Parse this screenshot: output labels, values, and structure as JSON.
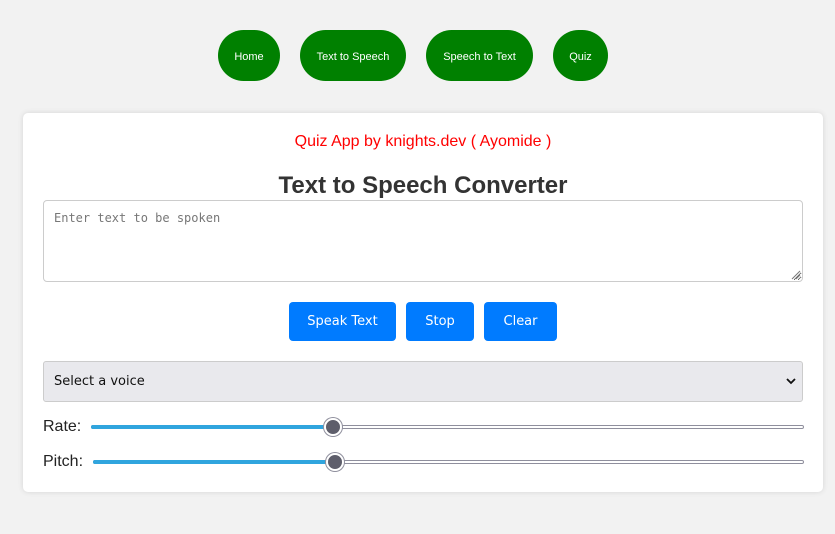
{
  "nav": {
    "items": [
      {
        "label": "Home"
      },
      {
        "label": "Text to Speech"
      },
      {
        "label": "Speech to Text"
      },
      {
        "label": "Quiz"
      }
    ]
  },
  "card": {
    "subtitle": "Quiz App by knights.dev ( Ayomide )",
    "title": "Text to Speech Converter",
    "textarea": {
      "placeholder": "Enter text to be spoken",
      "value": ""
    },
    "buttons": {
      "speak": "Speak Text",
      "stop": "Stop",
      "clear": "Clear"
    },
    "voice_select": {
      "selected": "Select a voice"
    },
    "rate": {
      "label": "Rate:",
      "level": 0.34
    },
    "pitch": {
      "label": "Pitch:",
      "level": 0.34
    }
  },
  "colors": {
    "nav_button": "#008000",
    "action_button": "#007bff",
    "subtitle": "#ff0000",
    "slider_fill": "#30a5de"
  }
}
